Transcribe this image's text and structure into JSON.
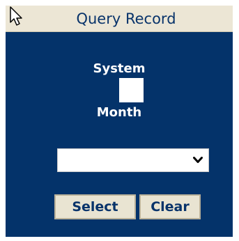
{
  "header": {
    "title": "Query Record"
  },
  "form": {
    "system_label": "System",
    "month_label": "Month",
    "system_checkbox_checked": false,
    "month_select_value": ""
  },
  "buttons": {
    "select_label": "Select",
    "clear_label": "Clear"
  },
  "colors": {
    "panel_background": "#04336a",
    "header_background": "#ece6d5",
    "button_background": "#e9e4d2",
    "accent_text": "#08336a",
    "label_text": "#ffffff"
  },
  "icons": {
    "cursor": "cursor-arrow-icon",
    "dropdown": "chevron-down-icon"
  }
}
